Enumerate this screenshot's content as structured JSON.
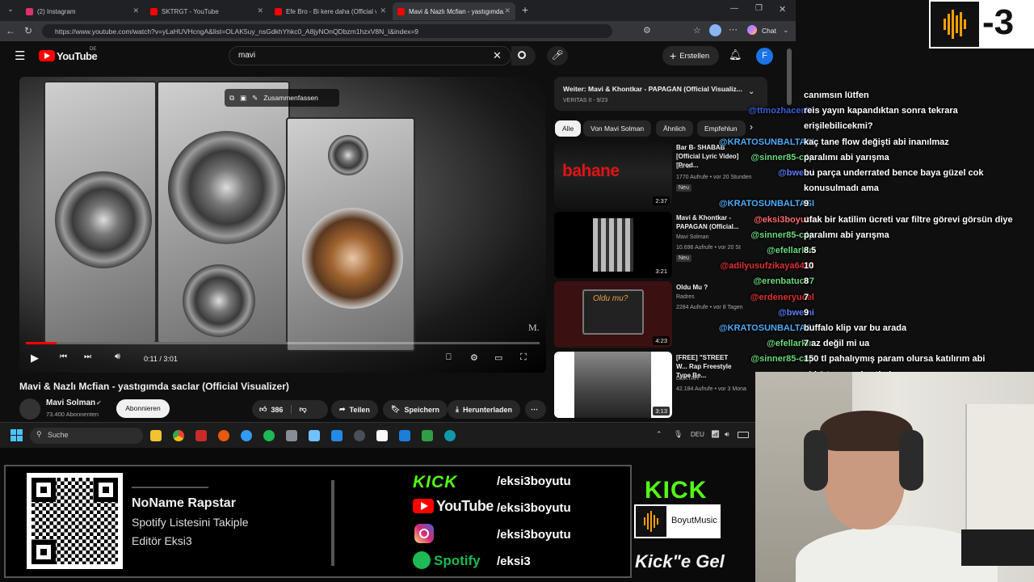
{
  "browser": {
    "tabs": [
      {
        "label": "(2) Instagram",
        "color": "#e1306c"
      },
      {
        "label": "SKTRGT - YouTube",
        "color": "#ff0000"
      },
      {
        "label": "Efe Bro - Bi kere daha (Official vid...",
        "color": "#ff0000"
      },
      {
        "label": "Mavi & Nazlı Mcfian - yastıgımda...",
        "color": "#ff0000"
      }
    ],
    "new_tab": "+",
    "url": "https://www.youtube.com/watch?v=yLaHUVHcngA&list=OLAK5uy_nsGdkhYhkc0_A8jyNOnQDbzm1hzxV8N_I&index=9",
    "chat_button": "Chat"
  },
  "youtube": {
    "logo": "YouTube",
    "logo_region": "DE",
    "search_value": "mavi",
    "create_label": "Erstellen",
    "avatar_letter": "F",
    "summarize_label": "Zusammenfassen",
    "time_display": "0:11 / 3:01",
    "watermark": "M.",
    "progress": 0.06,
    "title": "Mavi & Nazlı Mcfian - yastıgımda saclar (Official Visualizer)",
    "channel_name": "Mavi Solman",
    "subscribers": "73.400 Abonnenten",
    "subscribe_label": "Abonnieren",
    "likes": "386",
    "share_label": "Teilen",
    "save_label": "Speichern",
    "download_label": "Herunterladen",
    "playlist": {
      "title": "Weiter: Mavi & Khontkar - PAPAGAN (Official Visualiz...",
      "sub": "VERITAS II - 9/23"
    },
    "chips": [
      "Alle",
      "Von Mavi Solman",
      "Ähnlich",
      "Empfehlun"
    ],
    "recs": [
      {
        "title": "Bar B- SHABAB [Official Lyric Video] [Prod...",
        "channel": "Bar B",
        "meta": "1770 Aufrufe • vor 20 Stunden",
        "badge": "Neu",
        "duration": "2:37",
        "thumb_text": "bahane"
      },
      {
        "title": "Mavi & Khontkar - PAPAGAN (Official...",
        "channel": "Mavi Solman",
        "meta": "10.696 Aufrufe • vor 20 St",
        "badge": "Neu",
        "duration": "3:21",
        "thumb_text": ""
      },
      {
        "title": "Oldu Mu ?",
        "channel": "Radres",
        "meta": "2284 Aufrufe • vor 8 Tagen",
        "badge": "",
        "duration": "4:23",
        "thumb_text": "Oldu mu?"
      },
      {
        "title": "[FREE] \"STREET W... Rap Freestyle Type Be...",
        "channel": "DEXTAH",
        "meta": "42.184 Aufrufe • vor 3 Mona",
        "badge": "",
        "duration": "3:13",
        "thumb_text": ""
      }
    ]
  },
  "taskbar": {
    "search_placeholder": "Suche",
    "lang": "DEU"
  },
  "chat": {
    "messages": [
      {
        "user": "",
        "text": "canımsın lütfen",
        "color": "#7aa7ff"
      },
      {
        "user": "@ttmozhacer74",
        "text": "reis yayın kapandıktan sonra tekrara",
        "color": "#3b5bdb"
      },
      {
        "user": "",
        "text": "erişilebilicekmi?",
        "color": "#3b5bdb"
      },
      {
        "user": "@KRATOSUNBALTASI",
        "text": "kaç tane flow değişti abi inanılmaz",
        "color": "#4dabf7"
      },
      {
        "user": "@sinner85-c4p",
        "text": "paralımı abi yarışma",
        "color": "#69db7c"
      },
      {
        "user": "@bwemi",
        "text": "bu parça underrated bence baya güzel cok",
        "color": "#5c7cfa"
      },
      {
        "user": "",
        "text": "konusulmadı ama",
        "color": "#5c7cfa"
      },
      {
        "user": "@KRATOSUNBALTASI",
        "text": "9",
        "color": "#4dabf7"
      },
      {
        "user": "@eksi3boyutu",
        "text": "ufak bir katilim ücreti var filtre görevi görsün diye",
        "color": "#ff6b6b"
      },
      {
        "user": "@sinner85-c4p",
        "text": "paralımı abi yarışma",
        "color": "#69db7c"
      },
      {
        "user": "@efellarkin",
        "text": "8.5",
        "color": "#69db7c"
      },
      {
        "user": "@adilyusufzikaya6434",
        "text": "10",
        "color": "#e03131"
      },
      {
        "user": "@erenbatuc07",
        "text": "8",
        "color": "#69db7c"
      },
      {
        "user": "@erdeneryucel",
        "text": "7",
        "color": "#e03131"
      },
      {
        "user": "@bwemi",
        "text": "9",
        "color": "#5c7cfa"
      },
      {
        "user": "@KRATOSUNBALTASI",
        "text": "buffalo klip var bu arada",
        "color": "#4dabf7"
      },
      {
        "user": "@efellarkin",
        "text": "7 az değil mi ua",
        "color": "#69db7c"
      },
      {
        "user": "@sinner85-c4p",
        "text": "150 tl pahalıymış param olursa katılırım abi",
        "color": "#69db7c"
      },
      {
        "user": "",
        "text": "abi 2 tane şarkı atladın",
        "color": "#fff"
      }
    ]
  },
  "overlay": {
    "badge": "-3",
    "name": "NoName Rapstar",
    "line2": "Spotify Listesini Takiple",
    "line3": "Editör Eksi3",
    "socials": [
      {
        "platform": "KICK",
        "handle": "/eksi3boyutu",
        "color": "#53fc18"
      },
      {
        "platform": "YouTube",
        "handle": "/eksi3boyutu",
        "color": "#ff0000"
      },
      {
        "platform": "Instagram",
        "handle": "/eksi3boyutu",
        "color": "#e1306c"
      },
      {
        "platform": "Spotify",
        "handle": "/eksi3",
        "color": "#1db954"
      }
    ],
    "kick_logo": "KICK",
    "boyut_label": "BoyutMusic",
    "cta": "Kick\"e Gel"
  }
}
